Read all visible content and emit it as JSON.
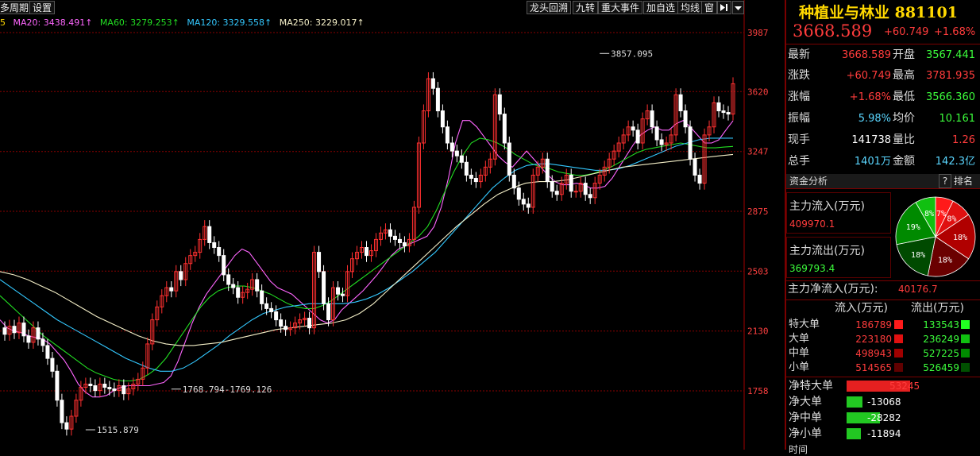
{
  "toolbar": {
    "left_buttons": [
      "多周期",
      "设置"
    ],
    "right_buttons": [
      "龙头回溯",
      "九转",
      "重大事件",
      "加自选",
      "均线",
      "窗"
    ]
  },
  "ma_legend": [
    {
      "label": "MA20: 3438.491↑",
      "color": "#ff66ff"
    },
    {
      "label": "MA60: 3279.253↑",
      "color": "#22dd22"
    },
    {
      "label": "MA120: 3329.558↑",
      "color": "#33c8ff"
    },
    {
      "label": "MA250: 3229.017↑",
      "color": "#f5f0c8"
    }
  ],
  "ma_prefix": "5",
  "chart_data": {
    "type": "candlestick",
    "y_ticks": [
      3987,
      3620,
      3247,
      2875,
      2503,
      2130,
      1758
    ],
    "ylim": [
      1500,
      4100
    ],
    "annotations": [
      {
        "text": "3857.095",
        "x": 126,
        "y": 3857.095
      },
      {
        "text": "1515.879",
        "x": 18,
        "y": 1515.879
      },
      {
        "text": "1768.794-1769.126",
        "x": 36,
        "y": 1769
      }
    ],
    "price_series": [
      2150,
      2110,
      2160,
      2120,
      2180,
      2100,
      2060,
      2150,
      2080,
      2040,
      1960,
      1880,
      1700,
      1560,
      1520,
      1600,
      1700,
      1780,
      1800,
      1790,
      1760,
      1800,
      1780,
      1770,
      1760,
      1790,
      1740,
      1770,
      1800,
      1830,
      1900,
      2050,
      2200,
      2280,
      2350,
      2400,
      2380,
      2500,
      2450,
      2550,
      2600,
      2620,
      2700,
      2780,
      2680,
      2650,
      2600,
      2480,
      2420,
      2400,
      2340,
      2370,
      2390,
      2450,
      2380,
      2300,
      2270,
      2250,
      2200,
      2160,
      2140,
      2150,
      2180,
      2200,
      2210,
      2150,
      2620,
      2500,
      2300,
      2200,
      2400,
      2360,
      2350,
      2500,
      2580,
      2620,
      2650,
      2600,
      2630,
      2700,
      2740,
      2760,
      2720,
      2700,
      2680,
      2660,
      2700,
      2900,
      3300,
      3500,
      3700,
      3640,
      3500,
      3400,
      3300,
      3250,
      3220,
      3180,
      3100,
      3080,
      3060,
      3100,
      3150,
      3200,
      3600,
      3480,
      3300,
      3100,
      3020,
      2950,
      2920,
      2900,
      3100,
      3150,
      3200,
      3060,
      3000,
      2980,
      3050,
      3100,
      3000,
      3000,
      3050,
      2980,
      2960,
      3050,
      3100,
      3150,
      3200,
      3250,
      3300,
      3350,
      3400,
      3380,
      3300,
      3450,
      3500,
      3400,
      3320,
      3290,
      3300,
      3350,
      3600,
      3500,
      3400,
      3200,
      3100,
      3050,
      3350,
      3400,
      3550,
      3500,
      3490,
      3480,
      3668.589
    ],
    "ma_series": [
      {
        "name": "MA20",
        "values": [
          2200,
          2150,
          2130,
          2120,
          2100,
          2090,
          2080,
          2050,
          2000,
          1950,
          1880,
          1800,
          1750,
          1720,
          1720,
          1730,
          1760,
          1780,
          1790,
          1790,
          1790,
          1790,
          1800,
          1810,
          1850,
          1940,
          2060,
          2180,
          2280,
          2360,
          2420,
          2480,
          2540,
          2600,
          2640,
          2620,
          2560,
          2500,
          2440,
          2400,
          2380,
          2360,
          2320,
          2280,
          2240,
          2200,
          2180,
          2200,
          2260,
          2300,
          2340,
          2380,
          2430,
          2480,
          2540,
          2600,
          2640,
          2660,
          2680,
          2700,
          2720,
          2780,
          2900,
          3080,
          3300,
          3440,
          3440,
          3400,
          3340,
          3280,
          3220,
          3180,
          3150,
          3200,
          3250,
          3200,
          3150,
          3100,
          3060,
          3040,
          3040,
          3050,
          3040,
          3020,
          3020,
          3030,
          3080,
          3150,
          3220,
          3290,
          3350,
          3380,
          3400,
          3380,
          3380,
          3420,
          3440,
          3400,
          3350,
          3300,
          3300,
          3320,
          3380,
          3438
        ]
      },
      {
        "name": "MA60",
        "values": [
          2350,
          2300,
          2250,
          2200,
          2150,
          2100,
          2060,
          2020,
          1980,
          1940,
          1900,
          1870,
          1850,
          1830,
          1820,
          1820,
          1830,
          1860,
          1900,
          1960,
          2040,
          2120,
          2200,
          2280,
          2340,
          2380,
          2400,
          2410,
          2410,
          2400,
          2380,
          2360,
          2330,
          2300,
          2280,
          2270,
          2270,
          2290,
          2320,
          2360,
          2400,
          2440,
          2480,
          2520,
          2560,
          2600,
          2640,
          2680,
          2720,
          2780,
          2880,
          3000,
          3120,
          3220,
          3300,
          3330,
          3320,
          3300,
          3270,
          3230,
          3200,
          3170,
          3150,
          3140,
          3120,
          3110,
          3100,
          3100,
          3110,
          3130,
          3150,
          3180,
          3210,
          3240,
          3260,
          3270,
          3280,
          3290,
          3300,
          3290,
          3280,
          3270,
          3270,
          3275,
          3279
        ]
      },
      {
        "name": "MA120",
        "values": [
          2450,
          2400,
          2350,
          2300,
          2250,
          2200,
          2160,
          2120,
          2080,
          2040,
          2000,
          1960,
          1930,
          1900,
          1880,
          1880,
          1900,
          1940,
          1990,
          2040,
          2100,
          2150,
          2200,
          2240,
          2260,
          2280,
          2290,
          2300,
          2300,
          2300,
          2300,
          2310,
          2330,
          2360,
          2400,
          2450,
          2500,
          2560,
          2620,
          2700,
          2780,
          2860,
          2940,
          3020,
          3080,
          3130,
          3160,
          3170,
          3170,
          3160,
          3150,
          3140,
          3130,
          3130,
          3140,
          3160,
          3190,
          3220,
          3250,
          3280,
          3300,
          3320,
          3330,
          3330,
          3330
        ]
      },
      {
        "name": "MA250",
        "values": [
          2500,
          2480,
          2450,
          2410,
          2370,
          2320,
          2270,
          2220,
          2180,
          2140,
          2100,
          2070,
          2050,
          2040,
          2040,
          2050,
          2060,
          2080,
          2100,
          2120,
          2140,
          2150,
          2160,
          2170,
          2180,
          2200,
          2240,
          2300,
          2380,
          2460,
          2540,
          2620,
          2700,
          2780,
          2850,
          2920,
          2980,
          3020,
          3050,
          3060,
          3060,
          3070,
          3090,
          3110,
          3130,
          3150,
          3160,
          3170,
          3180,
          3190,
          3200,
          3210,
          3220,
          3229
        ]
      }
    ]
  },
  "quote": {
    "title": "种植业与林业 881101",
    "price": "3668.589",
    "change": "+60.749",
    "change_pct": "+1.68%",
    "rows": [
      {
        "l1": "最新",
        "v1": "3668.589",
        "c1": "red",
        "l2": "开盘",
        "v2": "3567.441",
        "c2": "green"
      },
      {
        "l1": "涨跌",
        "v1": "+60.749",
        "c1": "red",
        "l2": "最高",
        "v2": "3781.935",
        "c2": "red"
      },
      {
        "l1": "涨幅",
        "v1": "+1.68%",
        "c1": "red",
        "l2": "最低",
        "v2": "3566.360",
        "c2": "green"
      },
      {
        "l1": "振幅",
        "v1": "5.98%",
        "c1": "cyan",
        "l2": "均价",
        "v2": "10.161",
        "c2": "green"
      },
      {
        "l1": "现手",
        "v1": "141738",
        "c1": "white",
        "l2": "量比",
        "v2": "1.26",
        "c2": "red"
      },
      {
        "l1": "总手",
        "v1": "1401万",
        "c1": "cyan",
        "l2": "金额",
        "v2": "142.3亿",
        "c2": "cyan"
      }
    ]
  },
  "funds": {
    "section_title": "资金分析",
    "help": "?",
    "rank": "排名",
    "inflow_label": "主力流入(万元)",
    "inflow_value": "409970.1",
    "outflow_label": "主力流出(万元)",
    "outflow_value": "369793.4",
    "net_label": "主力净流入(万元):",
    "net_value": "40176.7",
    "pie": [
      {
        "label": "7%",
        "value": 7,
        "color": "#ff1a1a"
      },
      {
        "label": "8%",
        "value": 8,
        "color": "#e01010"
      },
      {
        "label": "18%",
        "value": 18,
        "color": "#b00000"
      },
      {
        "label": "18%",
        "value": 18,
        "color": "#6a0000"
      },
      {
        "label": "18%",
        "value": 18,
        "color": "#004a00"
      },
      {
        "label": "19%",
        "value": 19,
        "color": "#008a00"
      },
      {
        "label": "8%",
        "value": 8,
        "color": "#10c010"
      }
    ],
    "col_in": "流入(万元)",
    "col_out": "流出(万元)",
    "table": [
      {
        "name": "特大单",
        "in": "186789",
        "out": "133543",
        "cin": "#ff1a1a",
        "cout": "#22ff22"
      },
      {
        "name": "大单",
        "in": "223180",
        "out": "236249",
        "cin": "#e01010",
        "cout": "#10c010"
      },
      {
        "name": "中单",
        "in": "498943",
        "out": "527225",
        "cin": "#a00000",
        "cout": "#008a00"
      },
      {
        "name": "小单",
        "in": "514565",
        "out": "526459",
        "cin": "#600000",
        "cout": "#005000"
      }
    ],
    "net": [
      {
        "name": "净特大单",
        "value": "53245",
        "amount": 53245
      },
      {
        "name": "净大单",
        "value": "-13068",
        "amount": -13068
      },
      {
        "name": "净中单",
        "value": "-28282",
        "amount": -28282
      },
      {
        "name": "净小单",
        "value": "-11894",
        "amount": -11894
      }
    ],
    "footer": "时间"
  }
}
